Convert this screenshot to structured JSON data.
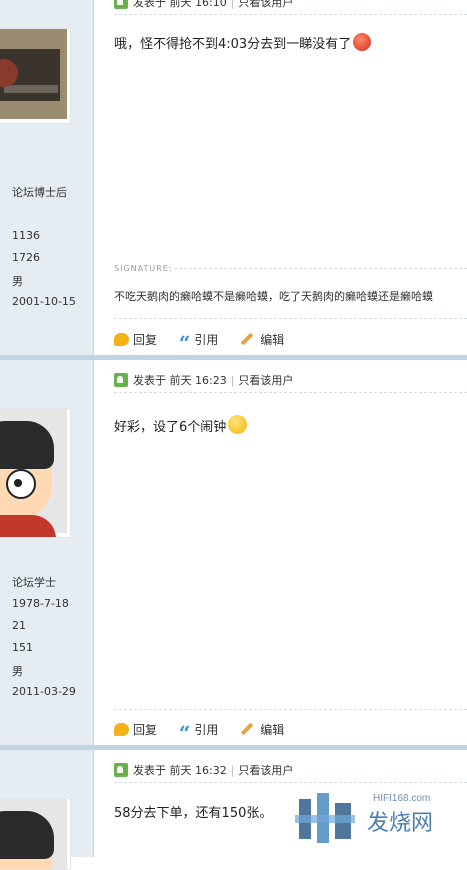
{
  "posts": [
    {
      "meta": {
        "posted": "发表于 前天 16:10",
        "only_author": "只看该用户"
      },
      "user": {
        "title": "论坛博士后",
        "stats": [
          "1136",
          "1726",
          "男",
          "2001-10-15"
        ]
      },
      "content": "哦，怪不得抢不到4:03分去到一睇没有了",
      "signature_label": "SIGNATURE:",
      "signature": "不吃天鹅肉的癞哈蟆不是癞哈蟆，吃了天鹅肉的癞哈蟆还是癞哈蟆",
      "actions": {
        "reply": "回复",
        "quote": "引用",
        "edit": "编辑"
      }
    },
    {
      "meta": {
        "posted": "发表于 前天 16:23",
        "only_author": "只看该用户"
      },
      "user": {
        "title": "论坛学士",
        "stats": [
          "1978-7-18",
          "21",
          "151",
          "男",
          "2011-03-29"
        ]
      },
      "content": "好彩，设了6个闹钟",
      "actions": {
        "reply": "回复",
        "quote": "引用",
        "edit": "编辑"
      }
    },
    {
      "meta": {
        "posted": "发表于 前天 16:32",
        "only_author": "只看该用户"
      },
      "content": "58分去下单，还有150张。"
    }
  ],
  "watermark": {
    "url": "HIFI168.com",
    "name": "发烧网"
  }
}
